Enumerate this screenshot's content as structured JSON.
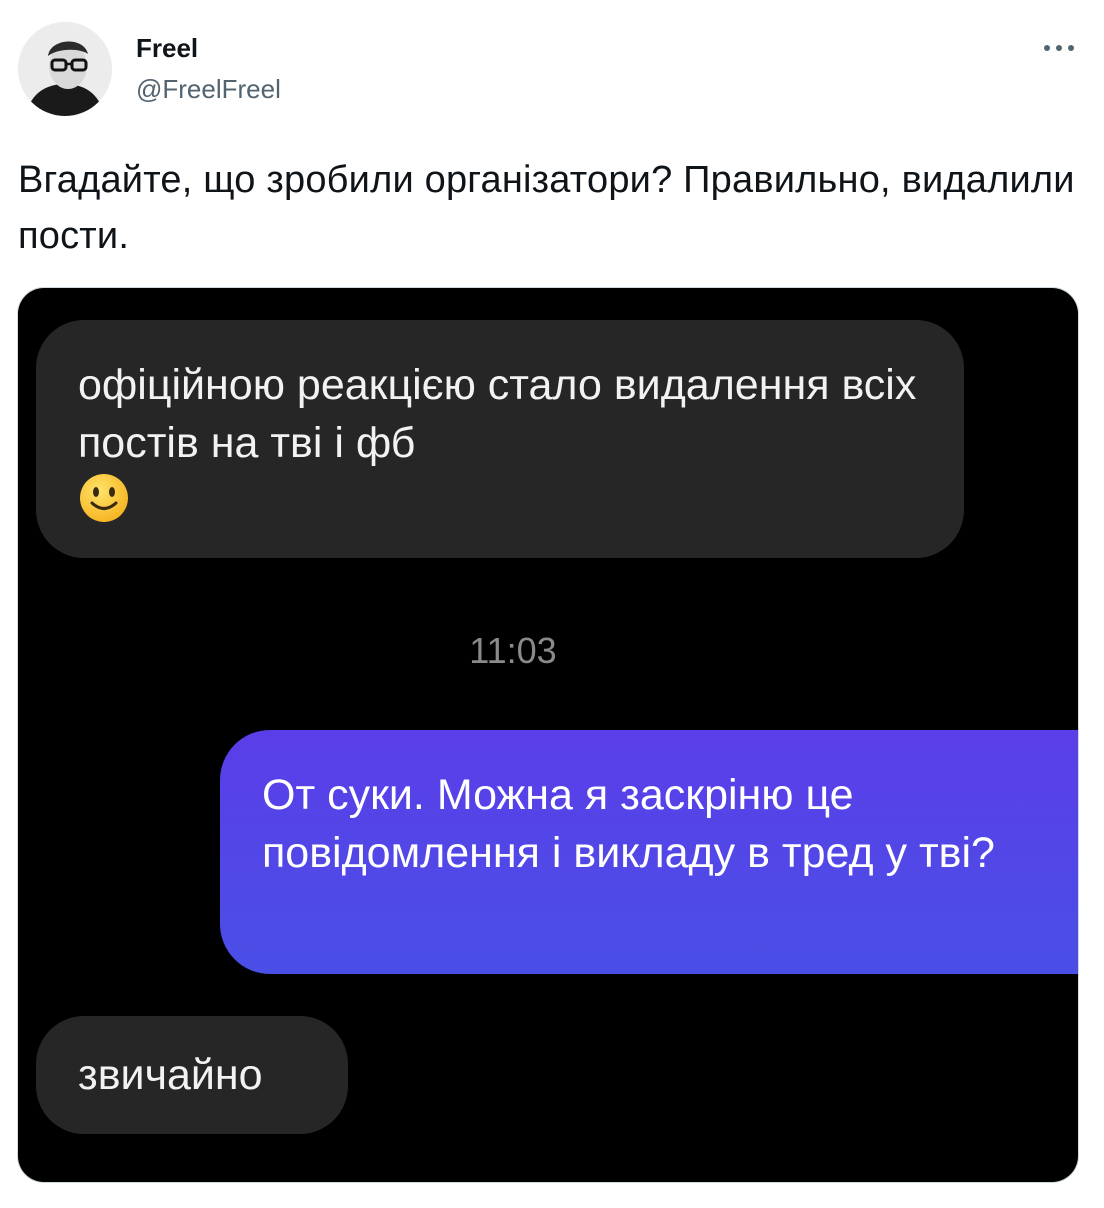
{
  "tweet": {
    "author": {
      "display_name": "Freel",
      "handle": "@FreelFreel",
      "avatar_icon": "avatar-photo"
    },
    "more_icon": "more-horizontal-icon",
    "text": "Вгадайте, що зробили організатори? Правильно, видалили пости."
  },
  "screenshot": {
    "messages": [
      {
        "direction": "incoming",
        "text": "офіційною реакцією стало видалення всіх постів на тві і фб",
        "emoji": "🙂"
      },
      {
        "direction": "timestamp",
        "text": "11:03"
      },
      {
        "direction": "outgoing",
        "text": "От суки. Можна я заскріню це повідомлення і викладу в тред у тві?"
      },
      {
        "direction": "incoming",
        "text": "звичайно"
      }
    ],
    "colors": {
      "background": "#000000",
      "incoming_bubble": "#262626",
      "outgoing_bubble": "#5141e6",
      "timestamp": "#8a8a8a"
    }
  }
}
